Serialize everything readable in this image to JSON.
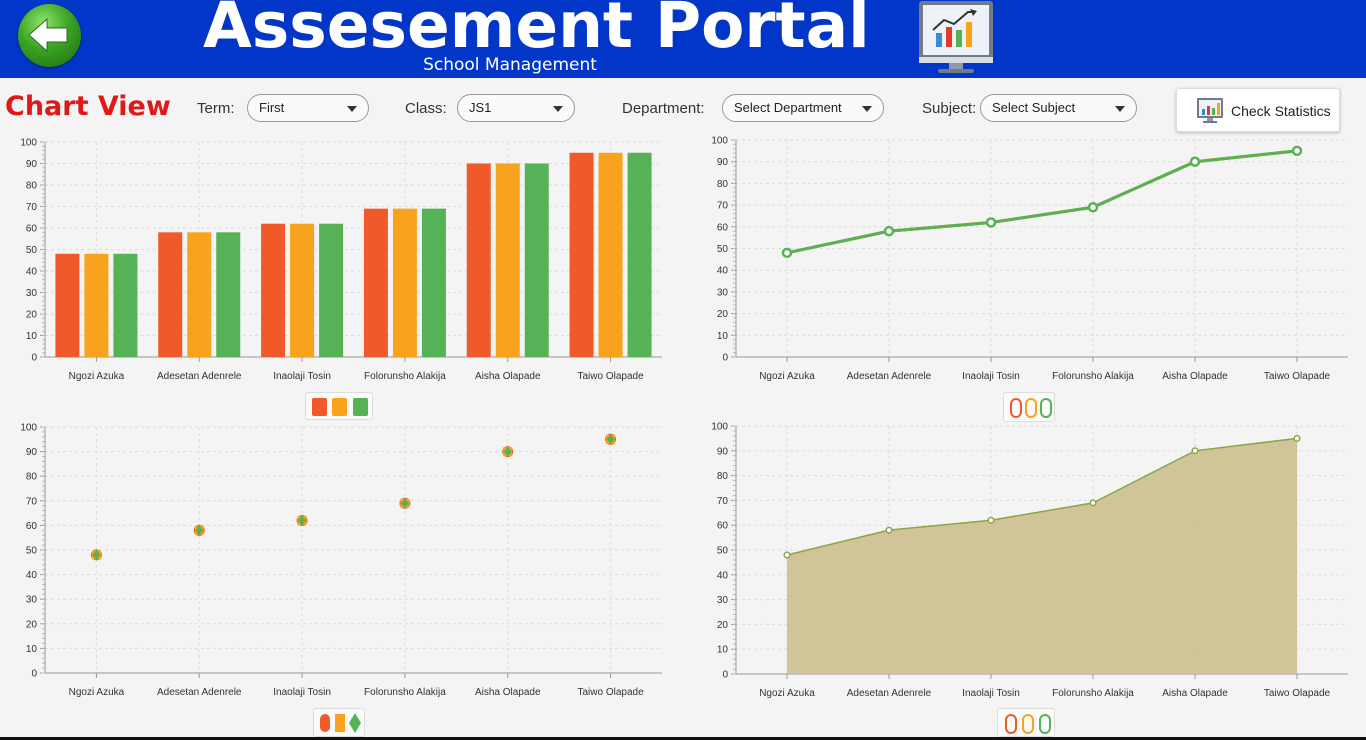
{
  "header": {
    "title": "Assesement Portal",
    "subtitle": "School Management",
    "back_icon": "back-arrow-icon",
    "monitor_icon": "chart-monitor-icon",
    "bg_color": "#0236c8"
  },
  "toolbar": {
    "view_title": "Chart View",
    "term_label": "Term:",
    "term_value": "First",
    "class_label": "Class:",
    "class_value": "JS1",
    "department_label": "Department:",
    "department_value": "Select Department",
    "subject_label": "Subject:",
    "subject_value": "Select Subject",
    "stats_button_label": "Check Statistics"
  },
  "colors": {
    "orange_red": "#f05a2a",
    "orange": "#f9a21e",
    "green": "#57b257",
    "area_fill": "#cfc192",
    "area_line": "#8aa64a",
    "title_red": "#e01818"
  },
  "chart_data": [
    {
      "type": "bar",
      "categories": [
        "Ngozi Azuka",
        "Adesetan Adenrele",
        "Inaolaji Tosin",
        "Folorunsho Alakija",
        "Aisha Olapade",
        "Taiwo Olapade"
      ],
      "series": [
        {
          "values": [
            48,
            58,
            62,
            69,
            90,
            95
          ],
          "color": "#f05a2a"
        },
        {
          "values": [
            48,
            58,
            62,
            69,
            90,
            95
          ],
          "color": "#f9a21e"
        },
        {
          "values": [
            48,
            58,
            62,
            69,
            90,
            95
          ],
          "color": "#57b257"
        }
      ],
      "ylim": [
        0,
        100
      ],
      "yticks": [
        0,
        10,
        20,
        30,
        40,
        50,
        60,
        70,
        80,
        90,
        100
      ],
      "grid": true,
      "legend_position": "bottom"
    },
    {
      "type": "line",
      "categories": [
        "Ngozi Azuka",
        "Adesetan Adenrele",
        "Inaolaji Tosin",
        "Folorunsho Alakija",
        "Aisha Olapade",
        "Taiwo Olapade"
      ],
      "series": [
        {
          "values": [
            48,
            58,
            62,
            69,
            90,
            95
          ],
          "color": "#f05a2a"
        },
        {
          "values": [
            48,
            58,
            62,
            69,
            90,
            95
          ],
          "color": "#f9a21e"
        },
        {
          "values": [
            48,
            58,
            62,
            69,
            90,
            95
          ],
          "color": "#57b257"
        }
      ],
      "ylim": [
        0,
        100
      ],
      "yticks": [
        0,
        10,
        20,
        30,
        40,
        50,
        60,
        70,
        80,
        90,
        100
      ],
      "grid": true,
      "legend_position": "bottom"
    },
    {
      "type": "scatter",
      "categories": [
        "Ngozi Azuka",
        "Adesetan Adenrele",
        "Inaolaji Tosin",
        "Folorunsho Alakija",
        "Aisha Olapade",
        "Taiwo Olapade"
      ],
      "series": [
        {
          "values": [
            48,
            58,
            62,
            69,
            90,
            95
          ],
          "color": "#f05a2a"
        },
        {
          "values": [
            48,
            58,
            62,
            69,
            90,
            95
          ],
          "color": "#f9a21e"
        },
        {
          "values": [
            48,
            58,
            62,
            69,
            90,
            95
          ],
          "color": "#57b257"
        }
      ],
      "ylim": [
        0,
        100
      ],
      "yticks": [
        0,
        10,
        20,
        30,
        40,
        50,
        60,
        70,
        80,
        90,
        100
      ],
      "grid": true,
      "legend_position": "bottom"
    },
    {
      "type": "area",
      "categories": [
        "Ngozi Azuka",
        "Adesetan Adenrele",
        "Inaolaji Tosin",
        "Folorunsho Alakija",
        "Aisha Olapade",
        "Taiwo Olapade"
      ],
      "series": [
        {
          "values": [
            48,
            58,
            62,
            69,
            90,
            95
          ],
          "color": "#cfc192"
        }
      ],
      "ylim": [
        0,
        100
      ],
      "yticks": [
        0,
        10,
        20,
        30,
        40,
        50,
        60,
        70,
        80,
        90,
        100
      ],
      "grid": true,
      "legend_position": "bottom"
    }
  ]
}
